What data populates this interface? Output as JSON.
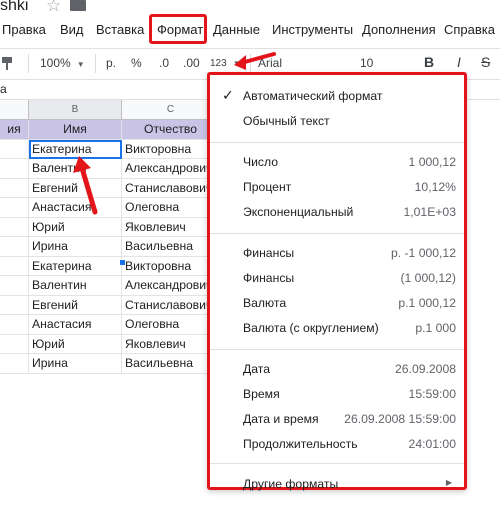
{
  "title_row": {
    "doc_title": "shki"
  },
  "menubar": {
    "items": [
      {
        "label": "Правка"
      },
      {
        "label": "Вид"
      },
      {
        "label": "Вставка"
      },
      {
        "label": "Формат"
      },
      {
        "label": "Данные"
      },
      {
        "label": "Инструменты"
      },
      {
        "label": "Дополнения"
      },
      {
        "label": "Справка"
      }
    ]
  },
  "toolbar": {
    "zoom": "100%",
    "currency": "р.",
    "percent": "%",
    "dec_decrease": ".0",
    "dec_increase": ".00",
    "more_formats": "123",
    "font": "Arial",
    "font_size": "10",
    "bold": "B",
    "italic": "I",
    "strike": "S"
  },
  "formula": {
    "cell_ref": "a"
  },
  "grid": {
    "col_headers": [
      "",
      "B",
      "C"
    ],
    "header_row": [
      "ия",
      "Имя",
      "Отчество"
    ],
    "rows": [
      [
        "",
        "Екатерина",
        "Викторовна"
      ],
      [
        "",
        "Валентин",
        "Александрович"
      ],
      [
        "",
        "Евгений",
        "Станиславович"
      ],
      [
        "",
        "Анастасия",
        "Олеговна"
      ],
      [
        "",
        "Юрий",
        "Яковлевич"
      ],
      [
        "",
        "Ирина",
        "Васильевна"
      ],
      [
        "",
        "Екатерина",
        "Викторовна"
      ],
      [
        "",
        "Валентин",
        "Александрович"
      ],
      [
        "",
        "Евгений",
        "Станиславович"
      ],
      [
        "",
        "Анастасия",
        "Олеговна"
      ],
      [
        "",
        "Юрий",
        "Яковлевич"
      ],
      [
        "",
        "Ирина",
        "Васильевна"
      ]
    ]
  },
  "format_menu": {
    "group1": [
      {
        "label": "Автоматический формат",
        "value": "",
        "checked": true
      },
      {
        "label": "Обычный текст",
        "value": ""
      }
    ],
    "group2": [
      {
        "label": "Число",
        "value": "1 000,12"
      },
      {
        "label": "Процент",
        "value": "10,12%"
      },
      {
        "label": "Экспоненциальный",
        "value": "1,01E+03"
      }
    ],
    "group3": [
      {
        "label": "Финансы",
        "value": "р. -1 000,12"
      },
      {
        "label": "Финансы",
        "value": "(1 000,12)"
      },
      {
        "label": "Валюта",
        "value": "р.1 000,12"
      },
      {
        "label": "Валюта (с округлением)",
        "value": "р.1 000"
      }
    ],
    "group4": [
      {
        "label": "Дата",
        "value": "26.09.2008"
      },
      {
        "label": "Время",
        "value": "15:59:00"
      },
      {
        "label": "Дата и время",
        "value": "26.09.2008 15:59:00"
      },
      {
        "label": "Продолжительность",
        "value": "24:01:00"
      }
    ],
    "more": {
      "label": "Другие форматы"
    }
  },
  "colors": {
    "highlight": "#e3151a",
    "header_fill": "#c9c3e6",
    "selection": "#1a73e8"
  },
  "icons": [
    "star-icon",
    "folder-icon",
    "paint-format-icon",
    "check-icon",
    "submenu-arrow-icon"
  ]
}
